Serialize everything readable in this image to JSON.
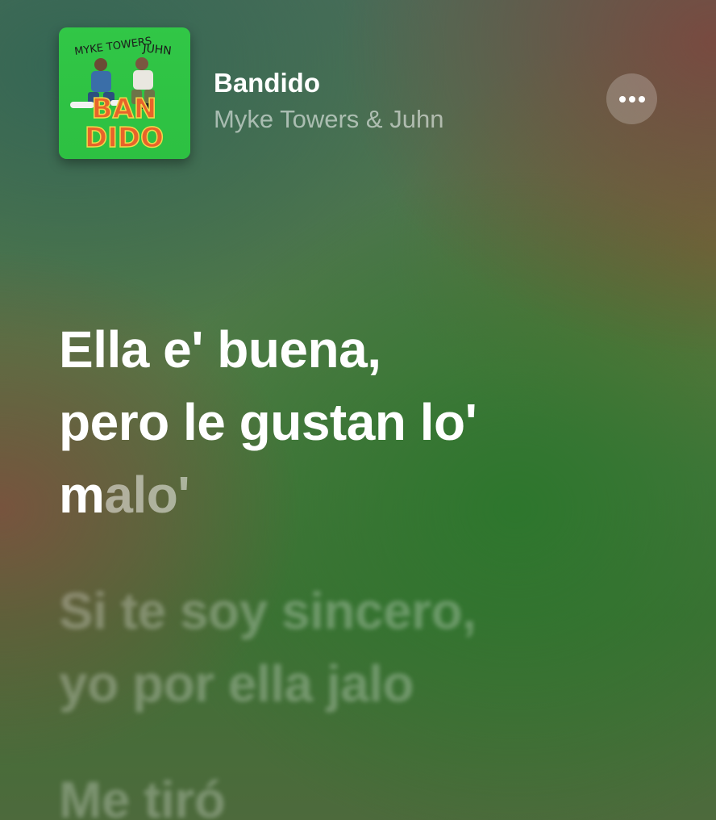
{
  "now_playing": {
    "title": "Bandido",
    "artist": "Myke Towers & Juhn",
    "album_art": {
      "label_line1": "BAN",
      "label_line2": "DIDO",
      "scribble_left": "MYKE TOWERS",
      "scribble_right": "JUHN",
      "background_color": "#33d14a",
      "text_color": "#e8632a"
    }
  },
  "lyrics": {
    "current_line": {
      "line1": "Ella e' buena,",
      "line2": "pero le gustan lo'",
      "line3_sung": "m",
      "line3_unsung": "alo'"
    },
    "next_line": {
      "line1": "Si te soy sincero,",
      "line2": "yo por ella jalo"
    },
    "following_line": {
      "line1": "Me tiró"
    }
  },
  "icons": {
    "more": "ellipsis-icon"
  }
}
